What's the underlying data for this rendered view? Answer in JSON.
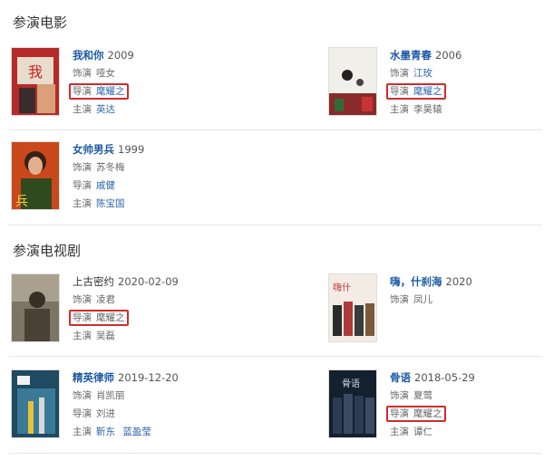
{
  "movies_section": {
    "title": "参演电影",
    "items": [
      {
        "title": "我和你",
        "date": "2009",
        "role_label": "饰演",
        "role": "哑女",
        "director_label": "导演",
        "director": "麾耀之",
        "starring_label": "主演",
        "starring": "英达",
        "starring2": ""
      },
      {
        "title": "水墨青春",
        "date": "2006",
        "role_label": "饰演",
        "role": "江玫",
        "director_label": "导演",
        "director": "麾耀之",
        "starring_label": "主演",
        "starring": "李昊辕",
        "starring2": ""
      },
      {
        "title": "女帅男兵",
        "date": "1999",
        "role_label": "饰演",
        "role": "苏冬梅",
        "director_label": "导演",
        "director": "戚健",
        "starring_label": "主演",
        "starring": "陈宝国",
        "starring2": ""
      }
    ]
  },
  "tv_section": {
    "title": "参演电视剧",
    "items": [
      {
        "title": "上古密约",
        "date": "2020-02-09",
        "role_label": "饰演",
        "role": "凌君",
        "director_label": "导演",
        "director": "麾耀之",
        "starring_label": "主演",
        "starring": "吴磊",
        "starring2": ""
      },
      {
        "title": "嗨，什刹海",
        "date": "2020",
        "role_label": "饰演",
        "role": "凤儿",
        "director_label": "",
        "director": "",
        "starring_label": "",
        "starring": "",
        "starring2": ""
      },
      {
        "title": "精英律师",
        "date": "2019-12-20",
        "role_label": "饰演",
        "role": "肖凯丽",
        "director_label": "导演",
        "director": "刘进",
        "starring_label": "主演",
        "starring": "靳东",
        "starring2": "蓝盈莹"
      },
      {
        "title": "骨语",
        "date": "2018-05-29",
        "role_label": "饰演",
        "role": "夏莺",
        "director_label": "导演",
        "director": "麾耀之",
        "starring_label": "主演",
        "starring": "谭仁",
        "starring2": ""
      }
    ]
  },
  "colors": {
    "link": "#1d5aa6",
    "highlight": "#d22b2b",
    "divider": "#e6e6e6"
  }
}
